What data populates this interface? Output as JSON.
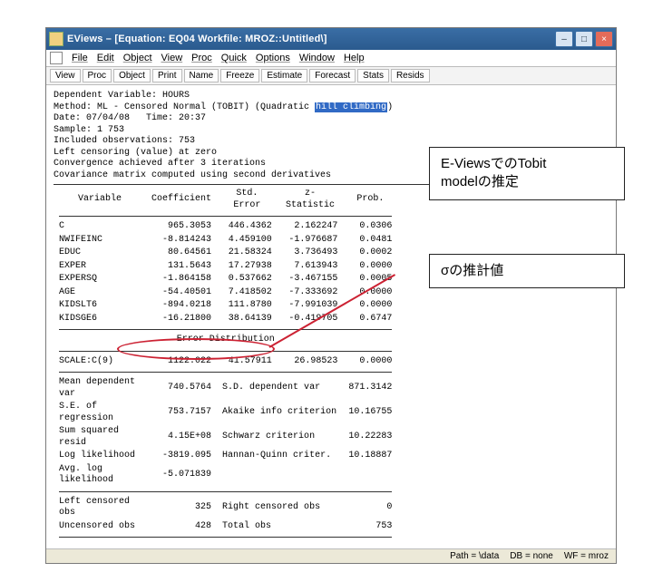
{
  "window": {
    "title": "EViews – [Equation: EQ04   Workfile: MROZ::Untitled\\]",
    "minLabel": "–",
    "maxLabel": "□",
    "closeLabel": "×"
  },
  "menu": [
    "File",
    "Edit",
    "Object",
    "View",
    "Proc",
    "Quick",
    "Options",
    "Window",
    "Help"
  ],
  "toolbar": [
    "View",
    "Proc",
    "Object",
    "Print",
    "Name",
    "Freeze",
    "Estimate",
    "Forecast",
    "Stats",
    "Resids"
  ],
  "info": {
    "l1": "Dependent Variable: HOURS",
    "l2a": "Method: ML - Censored Normal (TOBIT) (Quadratic ",
    "l2b": "hill climbing",
    "l2c": ")",
    "l3": "Date: 07/04/08   Time: 20:37",
    "l4": "Sample: 1 753",
    "l5": "Included observations: 753",
    "l6": "Left censoring (value) at zero",
    "l7": "Convergence achieved after 3 iterations",
    "l8": "Covariance matrix computed using second derivatives"
  },
  "hdr": {
    "v": "Variable",
    "c": "Coefficient",
    "s": "Std. Error",
    "z": "z-Statistic",
    "p": "Prob."
  },
  "coef": [
    {
      "v": "C",
      "c": "965.3053",
      "s": "446.4362",
      "z": "2.162247",
      "p": "0.0306"
    },
    {
      "v": "NWIFEINC",
      "c": "-8.814243",
      "s": "4.459100",
      "z": "-1.976687",
      "p": "0.0481"
    },
    {
      "v": "EDUC",
      "c": "80.64561",
      "s": "21.58324",
      "z": "3.736493",
      "p": "0.0002"
    },
    {
      "v": "EXPER",
      "c": "131.5643",
      "s": "17.27938",
      "z": "7.613943",
      "p": "0.0000"
    },
    {
      "v": "EXPERSQ",
      "c": "-1.864158",
      "s": "0.537662",
      "z": "-3.467155",
      "p": "0.0005"
    },
    {
      "v": "AGE",
      "c": "-54.40501",
      "s": "7.418502",
      "z": "-7.333692",
      "p": "0.0000"
    },
    {
      "v": "KIDSLT6",
      "c": "-894.0218",
      "s": "111.8780",
      "z": "-7.991039",
      "p": "0.0000"
    },
    {
      "v": "KIDSGE6",
      "c": "-16.21800",
      "s": "38.64139",
      "z": "-0.419705",
      "p": "0.6747"
    }
  ],
  "errdist_label": "Error Distribution",
  "scale": {
    "v": "SCALE:C(9)",
    "c": "1122.022",
    "s": "41.57911",
    "z": "26.98523",
    "p": "0.0000"
  },
  "stats": [
    {
      "a": "Mean dependent var",
      "av": "740.5764",
      "b": "S.D. dependent var",
      "bv": "871.3142"
    },
    {
      "a": "S.E. of regression",
      "av": "753.7157",
      "b": "Akaike info criterion",
      "bv": "10.16755"
    },
    {
      "a": "Sum squared resid",
      "av": "4.15E+08",
      "b": "Schwarz criterion",
      "bv": "10.22283"
    },
    {
      "a": "Log likelihood",
      "av": "-3819.095",
      "b": "Hannan-Quinn criter.",
      "bv": "10.18887"
    },
    {
      "a": "Avg. log likelihood",
      "av": "-5.071839",
      "b": "",
      "bv": ""
    }
  ],
  "cens": [
    {
      "a": "Left censored obs",
      "av": "325",
      "b": "Right censored obs",
      "bv": "0"
    },
    {
      "a": "Uncensored obs",
      "av": "428",
      "b": "Total obs",
      "bv": "753"
    }
  ],
  "status": {
    "path": "Path = \\data",
    "db": "DB = none",
    "wf": "WF = mroz"
  },
  "callout1a": "E-ViewsでのTobit",
  "callout1b": "modelの推定",
  "callout2": "σの推計値"
}
